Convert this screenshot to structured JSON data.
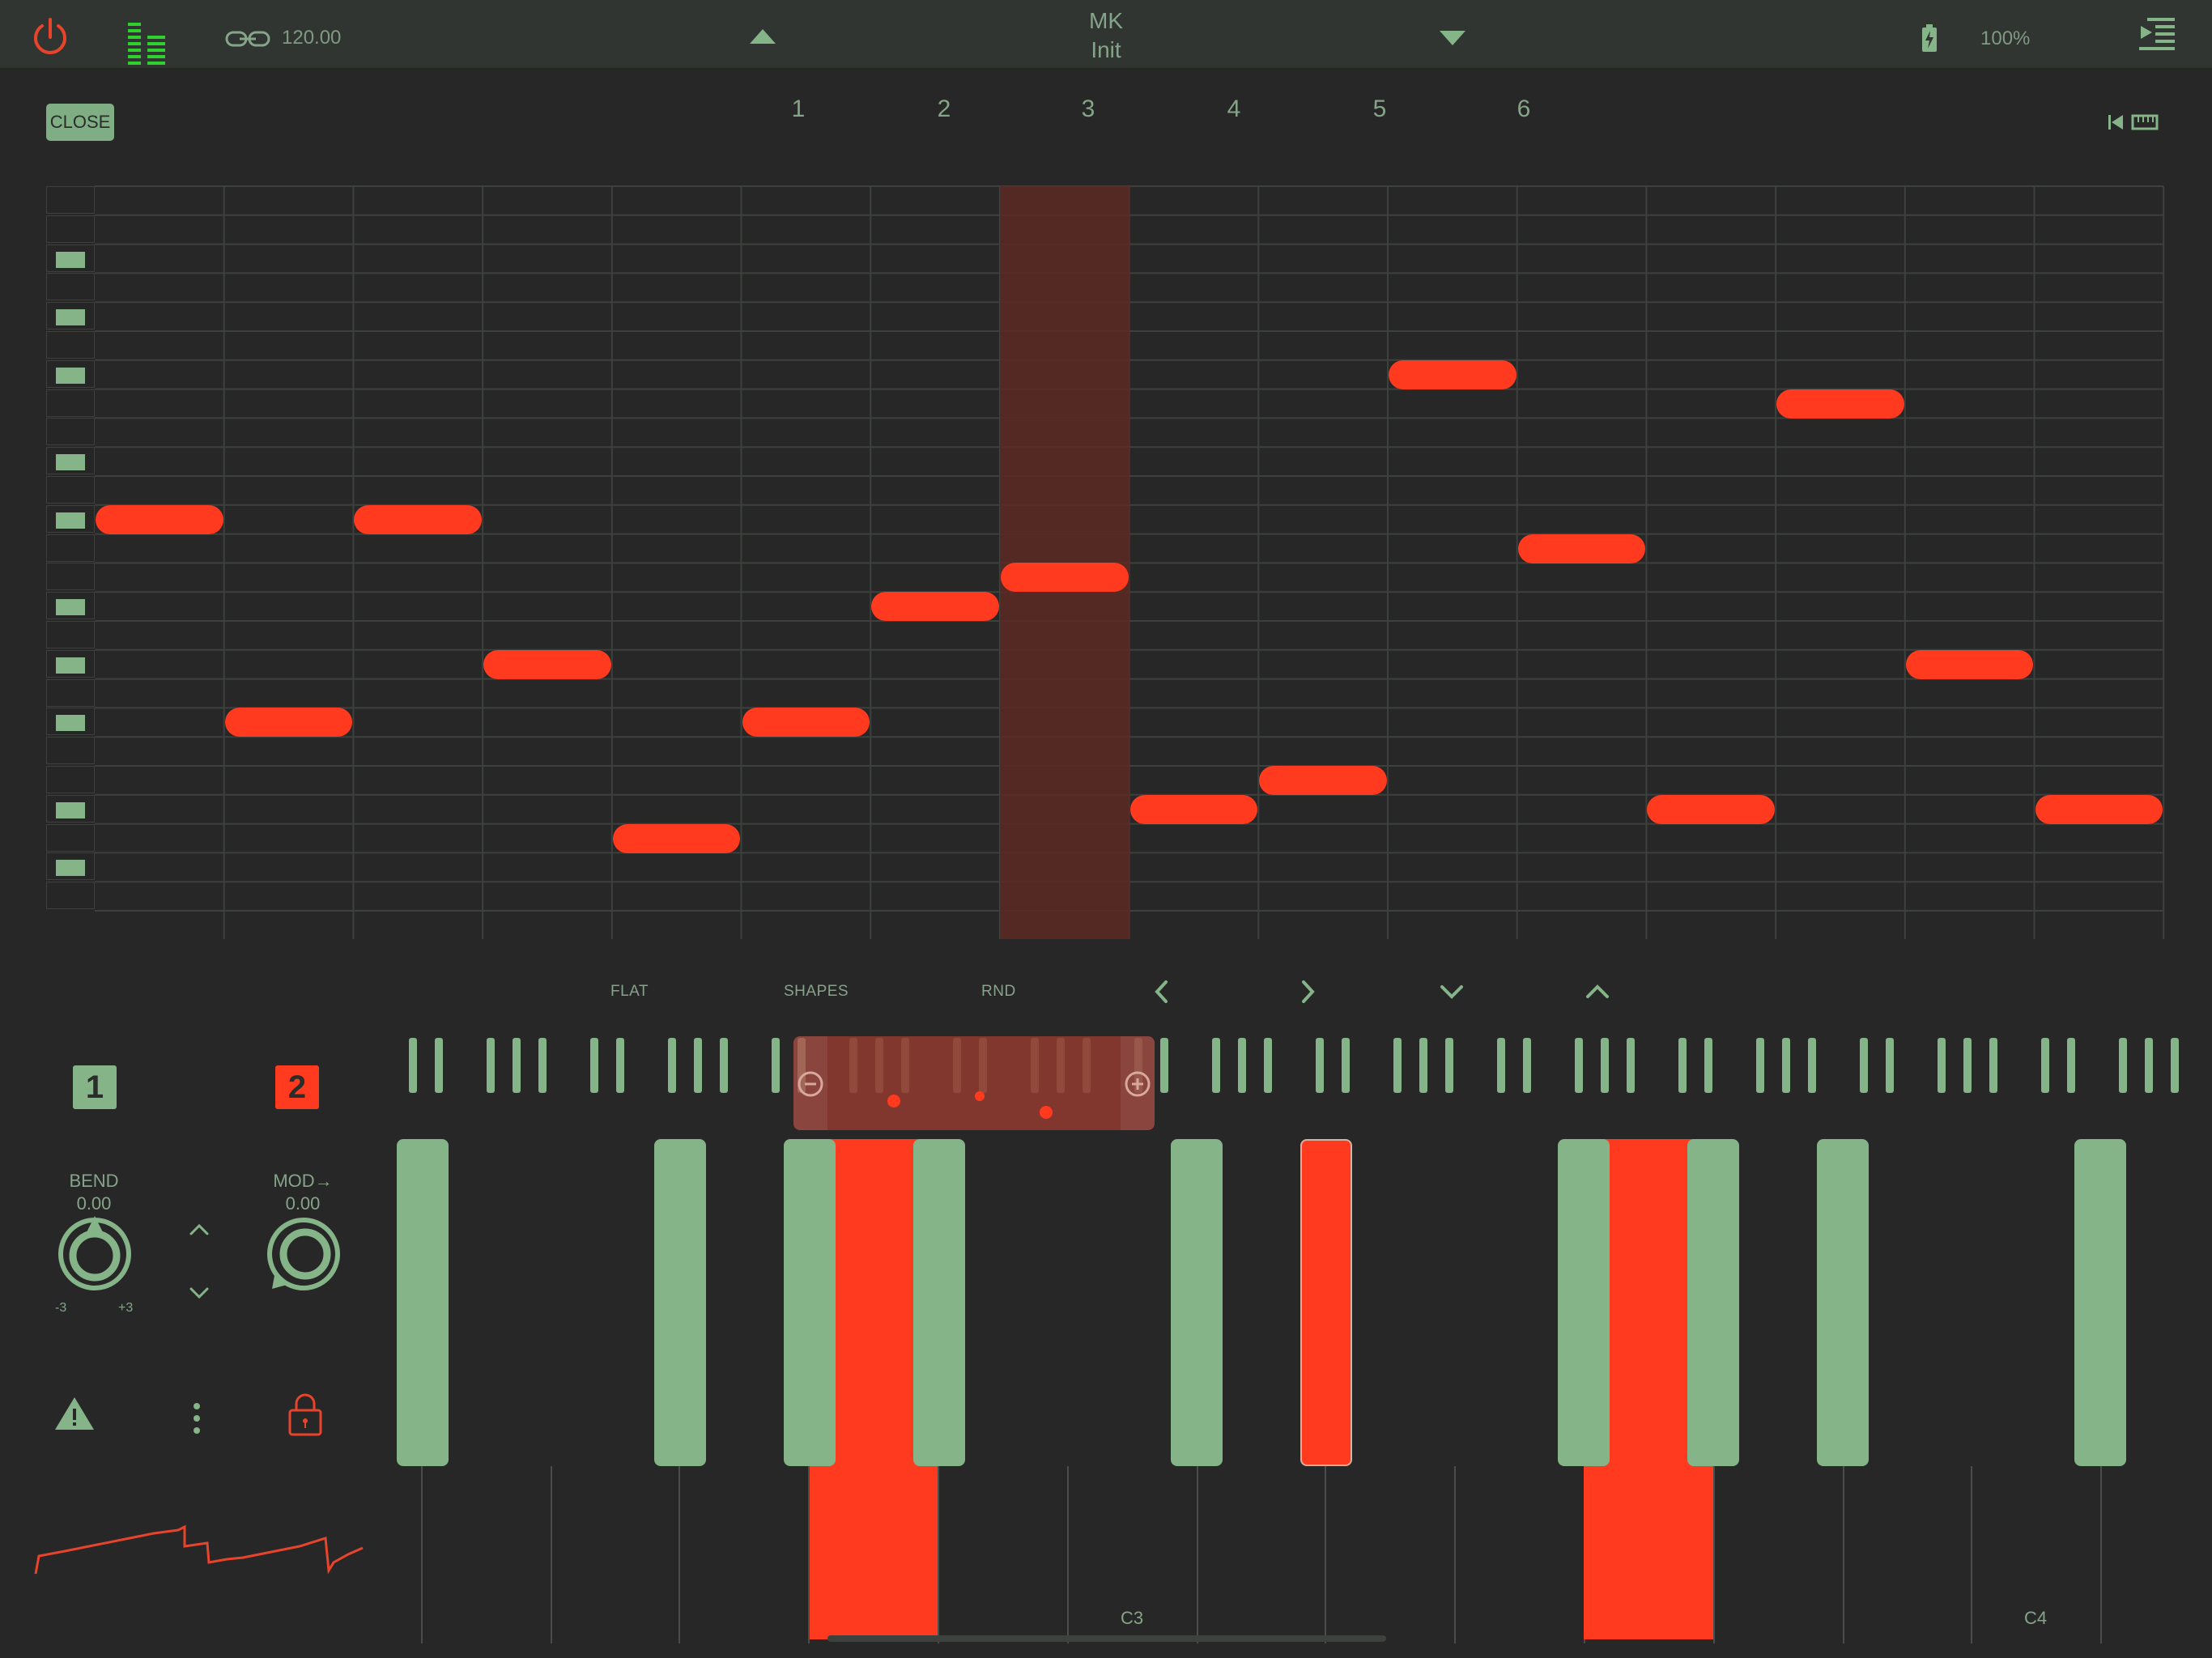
{
  "header": {
    "tempo": "120.00",
    "preset_bank": "MK",
    "preset_name": "Init",
    "battery": "100%"
  },
  "editor": {
    "close_label": "CLOSE",
    "bar_numbers": [
      "1",
      "2",
      "3",
      "4",
      "5",
      "6"
    ]
  },
  "toolbar": {
    "flat_label": "FLAT",
    "shapes_label": "SHAPES",
    "rnd_label": "RND"
  },
  "controls": {
    "channel_1": "1",
    "channel_2": "2",
    "bend_label": "BEND",
    "bend_value": "0.00",
    "bend_min": "-3",
    "bend_max": "+3",
    "mod_label": "MOD→",
    "mod_value": "0.00"
  },
  "keyboard": {
    "octave_c3": "C3",
    "octave_c4": "C4"
  },
  "colors": {
    "accent": "#ff3a1f",
    "key_green": "#86b489",
    "background": "#272727",
    "header": "#313531"
  }
}
